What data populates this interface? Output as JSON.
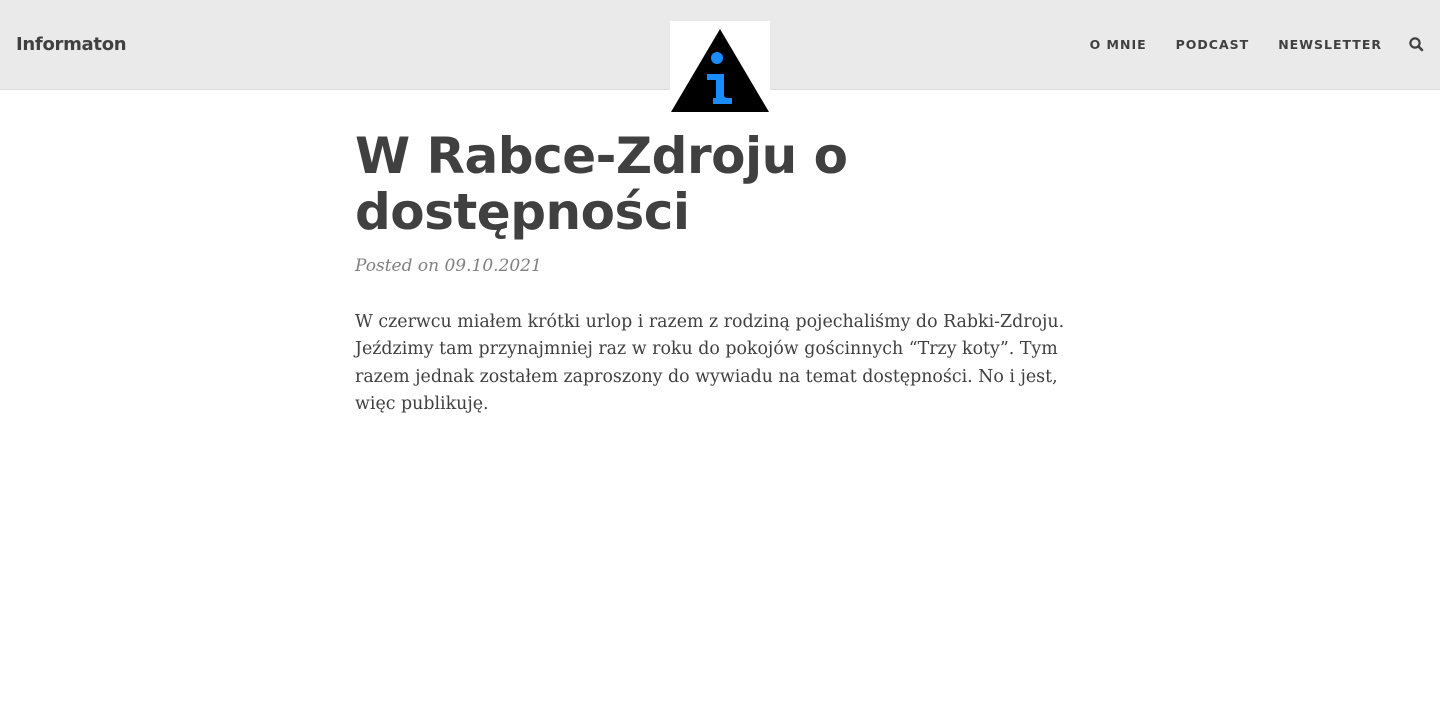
{
  "navbar": {
    "brand": "Informaton",
    "links": [
      {
        "label": "O MNIE"
      },
      {
        "label": "PODCAST"
      },
      {
        "label": "NEWSLETTER"
      }
    ],
    "search_icon": "search-icon"
  },
  "logo": {
    "icon": "info-triangle-logo",
    "triangle_color": "#000000",
    "letter_color": "#1a8cff"
  },
  "post": {
    "title": "W Rabce-Zdroju o dostępności",
    "meta": "Posted on 09.10.2021",
    "body": "W czerwcu miałem krótki urlop i razem z rodziną pojechaliśmy do Rabki-Zdroju. Jeździmy tam przynajmniej raz w roku do pokojów gościnnych “Trzy koty”. Tym razem jednak zostałem zaproszony do wywiadu na temat dostępności. No i jest, więc publikuję."
  }
}
